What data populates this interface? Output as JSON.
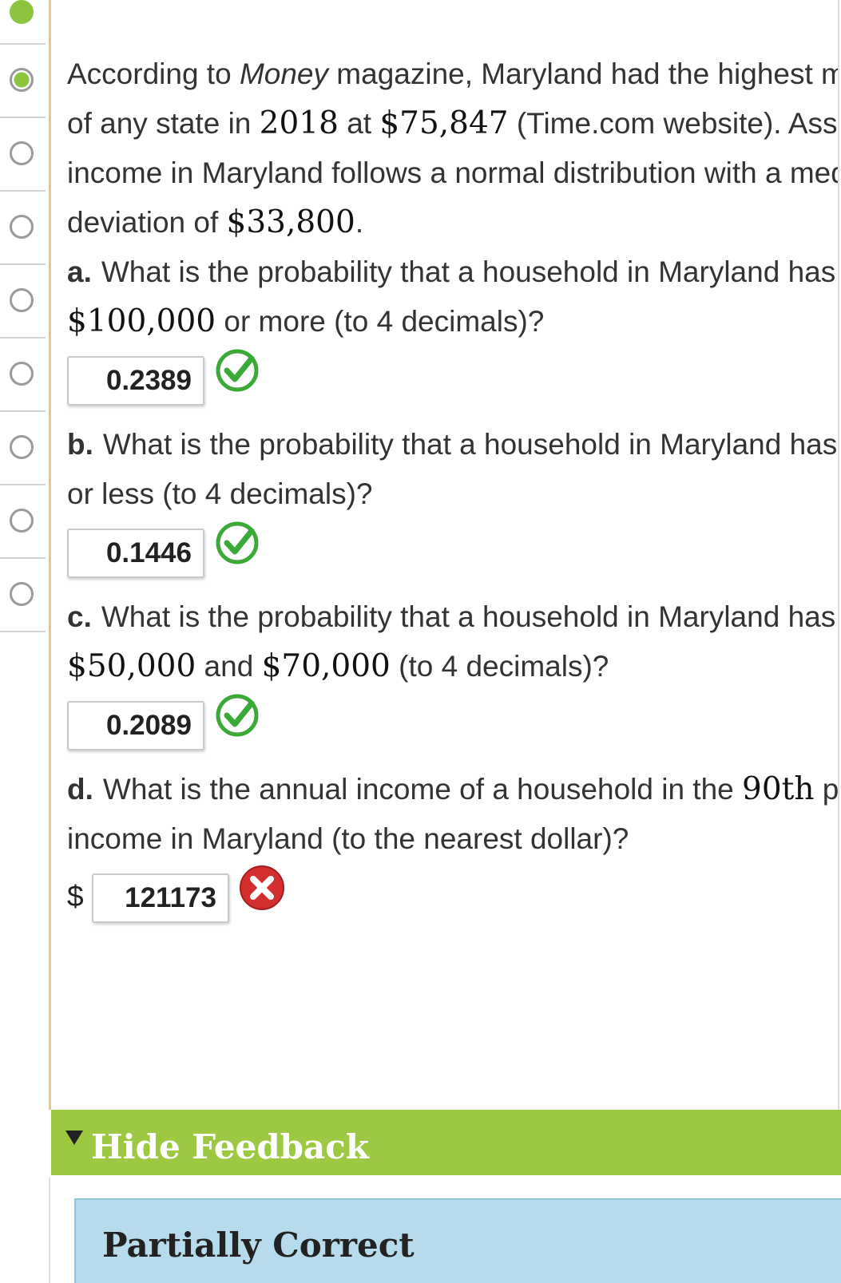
{
  "problem": {
    "line1_a": "According to ",
    "line1_b": "Money",
    "line1_c": " magazine, Maryland had the highest me",
    "line2_a": "of any state in ",
    "line2_year": "2018",
    "line2_b": " at ",
    "line2_amount": "$75,847",
    "line2_c": " (Time.com website). Assun",
    "line3": "income in Maryland follows a normal distribution with a med",
    "line4_a": "deviation of ",
    "line4_amount": "$33,800",
    "line4_b": "."
  },
  "parts": {
    "a": {
      "letter": "a.",
      "line1": "What is the probability that a household in Maryland has a",
      "line2_amount": "$100,000",
      "line2_text": " or more (to 4 decimals)?",
      "answer": "0.2389",
      "status": "correct"
    },
    "b": {
      "letter": "b.",
      "line1": "What is the probability that a household in Maryland has a",
      "line2_text": "or less (to 4 decimals)?",
      "answer": "0.1446",
      "status": "correct"
    },
    "c": {
      "letter": "c.",
      "line1": "What is the probability that a household in Maryland has a",
      "line2_amount1": "$50,000",
      "line2_and": " and ",
      "line2_amount2": "$70,000",
      "line2_text": " (to 4 decimals)?",
      "answer": "0.2089",
      "status": "correct"
    },
    "d": {
      "letter": "d.",
      "line1_a": "What is the annual income of a household in the ",
      "line1_pct": "90th",
      "line1_b": " per",
      "line2_text": "income in Maryland (to the nearest dollar)?",
      "currency": "$",
      "answer": "121173",
      "status": "incorrect"
    }
  },
  "feedback": {
    "toggle_label": "Hide Feedback",
    "result_label": "Partially Correct"
  },
  "colors": {
    "correct_green": "#3aa935",
    "incorrect_red": "#d32f2f",
    "feedback_bar": "#9dc842",
    "result_box": "#b5dbec"
  }
}
